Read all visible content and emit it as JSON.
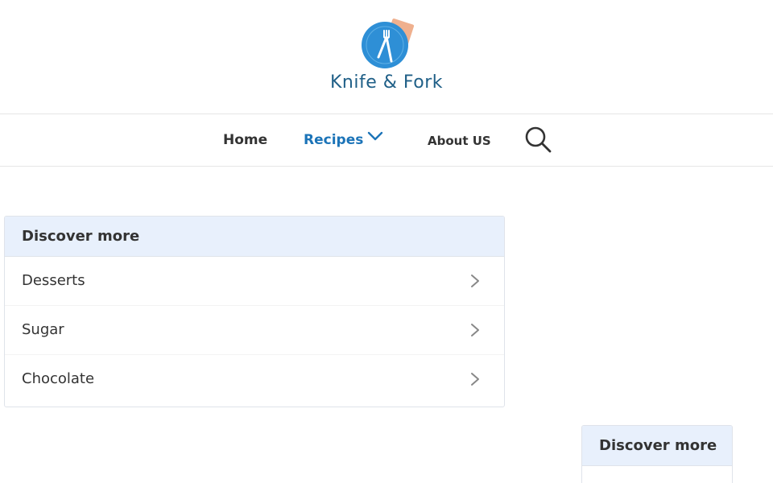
{
  "site": {
    "logo_text": "Knife & Fork",
    "logo_icon": "plate-fork-knife-icon"
  },
  "nav": {
    "items": [
      {
        "label": "Home"
      },
      {
        "label": "Recipes"
      },
      {
        "label": "About US"
      }
    ],
    "search_icon": "search-icon",
    "chevron_icon": "chevron-down-icon"
  },
  "discover": {
    "title": "Discover more",
    "items": [
      {
        "label": "Desserts"
      },
      {
        "label": "Sugar"
      },
      {
        "label": "Chocolate"
      }
    ]
  },
  "discover_side": {
    "title": "Discover more"
  },
  "colors": {
    "brand_blue": "#1c74b8",
    "logo_text": "#1f5f87",
    "panel_header_bg": "#e8f0fc"
  }
}
